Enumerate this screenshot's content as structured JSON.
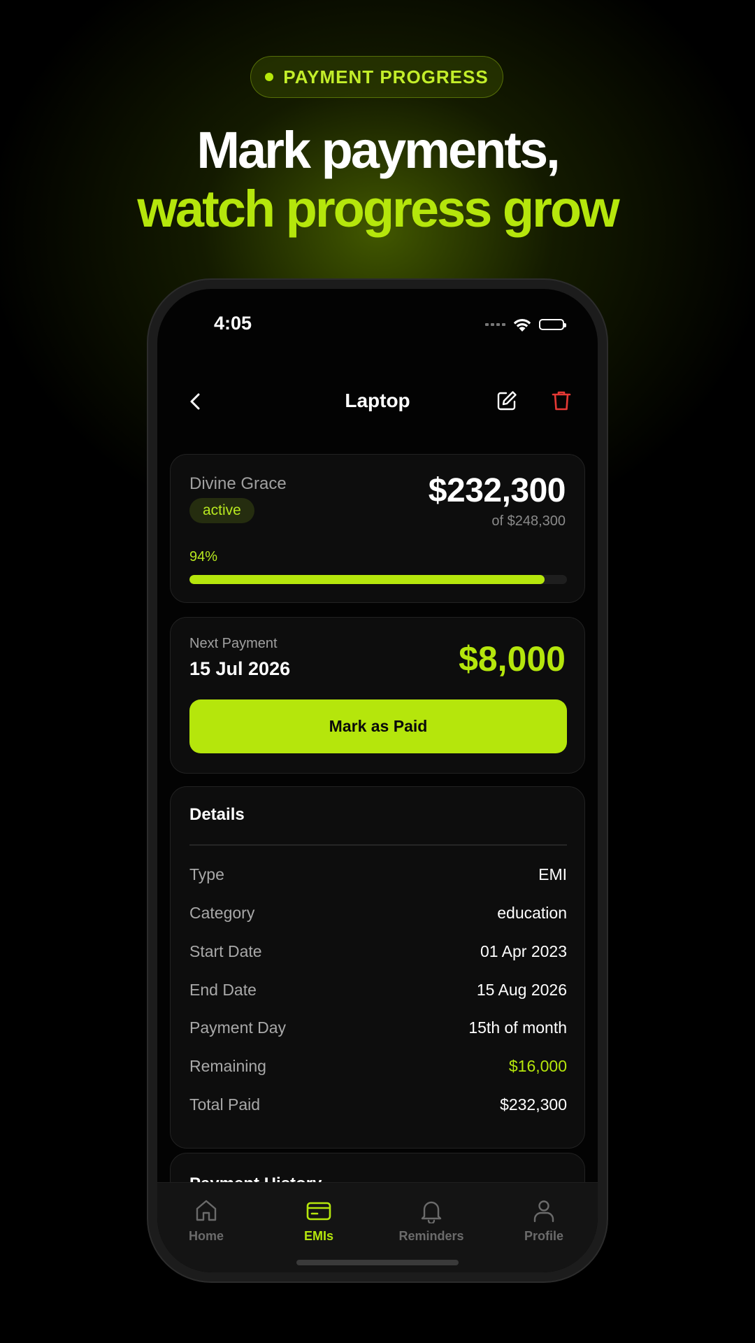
{
  "promo": {
    "pill_label": "PAYMENT PROGRESS",
    "headline_line1": "Mark payments,",
    "headline_line2": "watch progress grow"
  },
  "status_bar": {
    "time": "4:05"
  },
  "nav": {
    "title": "Laptop"
  },
  "summary": {
    "owner": "Divine Grace",
    "status_badge": "active",
    "paid_amount": "$232,300",
    "total_label": "of $248,300",
    "progress_label": "94%",
    "progress_fraction": 0.94
  },
  "next_payment": {
    "label": "Next Payment",
    "date": "15 Jul 2026",
    "amount": "$8,000",
    "button_label": "Mark as Paid"
  },
  "details": {
    "title": "Details",
    "rows": [
      {
        "label": "Type",
        "value": "EMI"
      },
      {
        "label": "Category",
        "value": "education"
      },
      {
        "label": "Start Date",
        "value": "01 Apr 2023"
      },
      {
        "label": "End Date",
        "value": "15 Aug 2026"
      },
      {
        "label": "Payment Day",
        "value": "15th of month"
      },
      {
        "label": "Remaining",
        "value": "$16,000"
      },
      {
        "label": "Total Paid",
        "value": "$232,300"
      }
    ]
  },
  "payment_history": {
    "title": "Payment History"
  },
  "tabbar": {
    "tabs": [
      {
        "label": "Home",
        "icon": "home-icon"
      },
      {
        "label": "EMIs",
        "icon": "card-icon"
      },
      {
        "label": "Reminders",
        "icon": "bell-icon"
      },
      {
        "label": "Profile",
        "icon": "user-icon"
      }
    ],
    "active": "EMIs"
  },
  "colors": {
    "accent": "#b5e60c",
    "danger": "#e53935",
    "background": "#000000",
    "card": "#0d0d0d"
  }
}
